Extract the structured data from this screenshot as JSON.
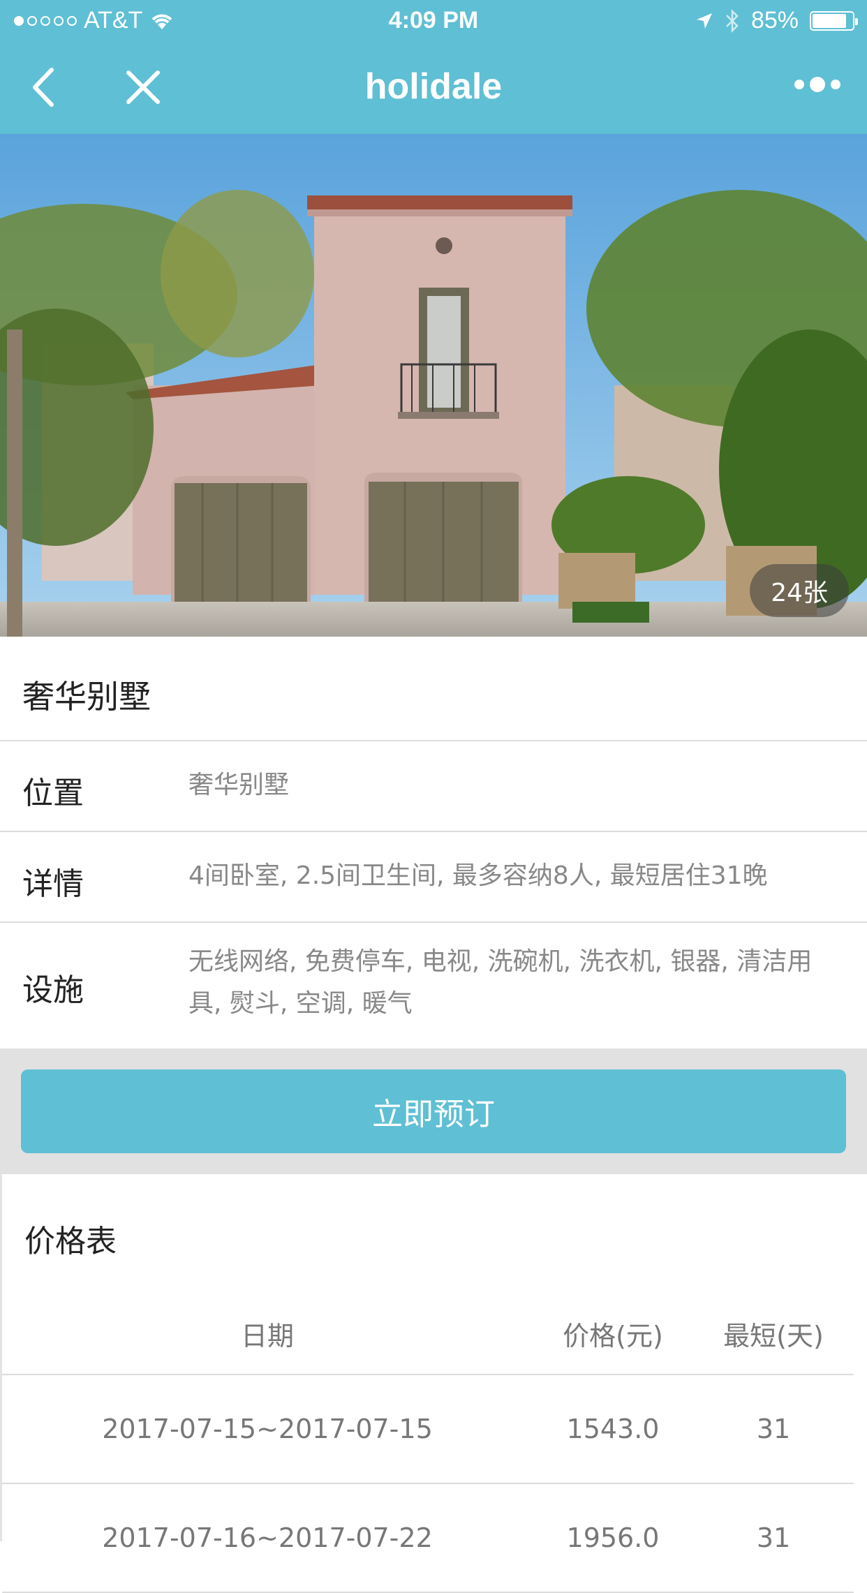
{
  "status_bar": {
    "carrier": "AT&T",
    "time": "4:09 PM",
    "battery": "85%",
    "battery_level": 0.85,
    "signal_bars_filled": 1,
    "icons": [
      "signal-dots-icon",
      "wifi-icon",
      "location-arrow-icon",
      "bluetooth-icon",
      "battery-icon"
    ]
  },
  "nav": {
    "title": "holidale",
    "icons": [
      "back-chevron-icon",
      "close-x-icon",
      "more-dots-icon"
    ]
  },
  "hero": {
    "photo_count": "24张"
  },
  "listing": {
    "name": "奢华别墅",
    "rows": [
      {
        "label": "位置",
        "value": "奢华别墅"
      },
      {
        "label": "详情",
        "value": "4间卧室, 2.5间卫生间, 最多容纳8人, 最短居住31晚"
      },
      {
        "label": "设施",
        "value": "无线网络, 免费停车, 电视, 洗碗机, 洗衣机, 银器, 清洁用具, 熨斗, 空调, 暖气"
      }
    ]
  },
  "book_button": "立即预订",
  "price_table": {
    "title": "价格表",
    "headers": [
      "日期",
      "价格(元)",
      "最短(天)"
    ],
    "rows": [
      [
        "2017-07-15~2017-07-15",
        "1543.0",
        "31"
      ],
      [
        "2017-07-16~2017-07-22",
        "1956.0",
        "31"
      ]
    ]
  },
  "colors": {
    "accent": "#5fbfd4",
    "divider": "#dcdcdc",
    "muted_text": "#888888"
  }
}
